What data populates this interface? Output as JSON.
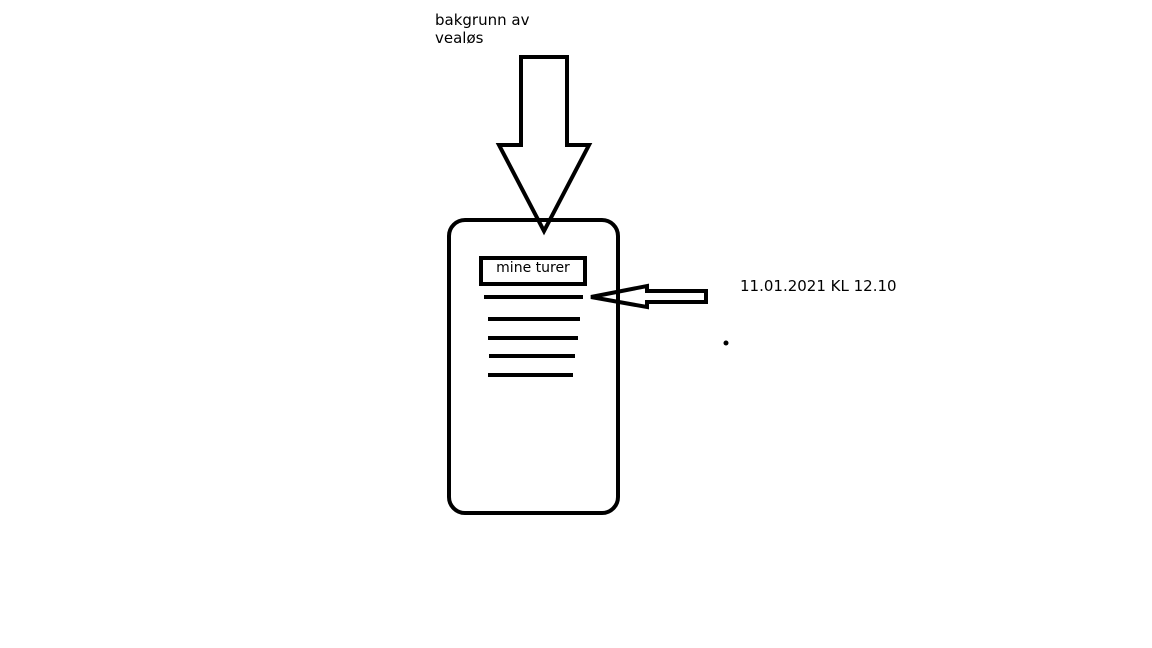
{
  "annotations": {
    "background": {
      "line1": "bakgrunn av",
      "line2": "vealøs"
    },
    "timestamp": "11.01.2021 KL 12.10"
  },
  "phone": {
    "title": "mine turer",
    "list_items": 5
  },
  "colors": {
    "ink": "#000000",
    "paper": "#ffffff"
  }
}
